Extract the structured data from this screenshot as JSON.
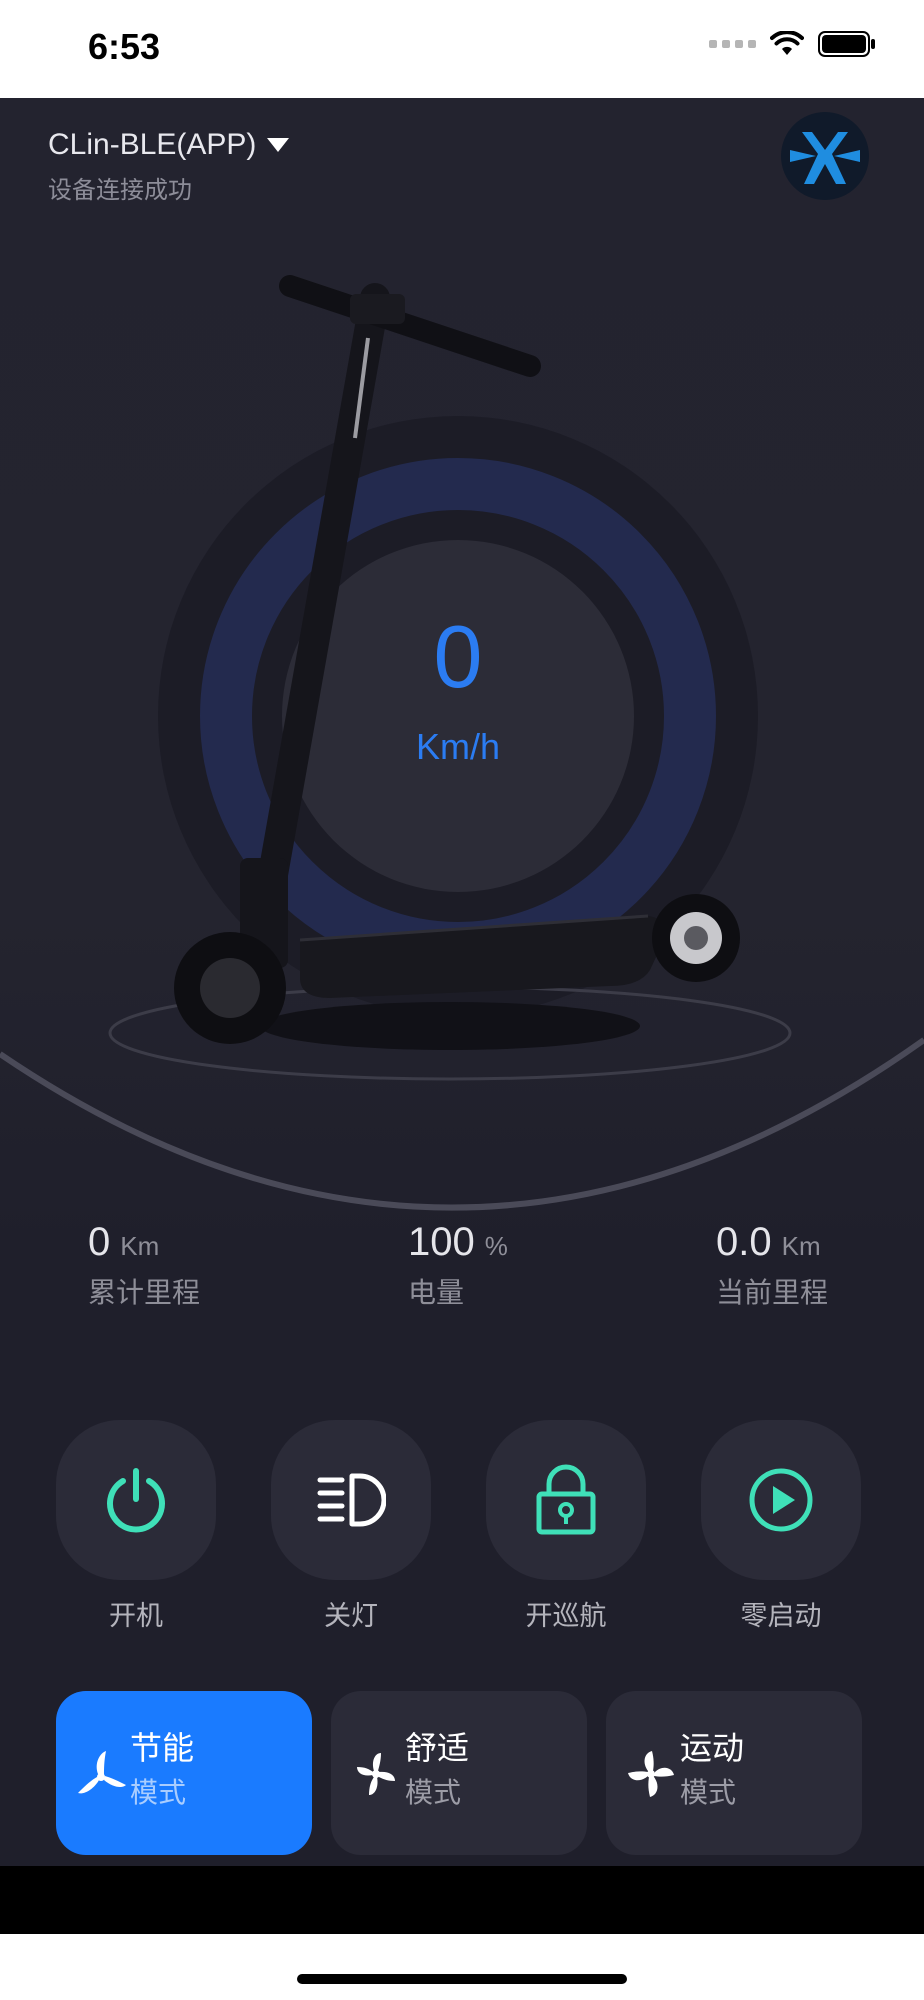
{
  "status_bar": {
    "time": "6:53",
    "icons": [
      "cellular-signal-icon",
      "wifi-icon",
      "battery-icon"
    ]
  },
  "header": {
    "device_name": "CLin-BLE(APP)",
    "connection_status": "设备连接成功",
    "logo_icon": "brand-logo-icon"
  },
  "speed": {
    "value": "0",
    "unit": "Km/h"
  },
  "stats": [
    {
      "value": "0",
      "unit": "Km",
      "label": "累计里程"
    },
    {
      "value": "100",
      "unit": "%",
      "label": "电量"
    },
    {
      "value": "0.0",
      "unit": "Km",
      "label": "当前里程"
    }
  ],
  "controls": [
    {
      "label": "开机",
      "icon": "power-icon"
    },
    {
      "label": "关灯",
      "icon": "headlight-icon"
    },
    {
      "label": "开巡航",
      "icon": "lock-open-icon"
    },
    {
      "label": "零启动",
      "icon": "play-icon"
    }
  ],
  "modes": [
    {
      "name": "节能",
      "sub": "模式",
      "icon": "fan-icon",
      "active": true
    },
    {
      "name": "舒适",
      "sub": "模式",
      "icon": "fan-icon",
      "active": false
    },
    {
      "name": "运动",
      "sub": "模式",
      "icon": "fan-icon",
      "active": false
    }
  ],
  "colors": {
    "background": "#1f1f2b",
    "accent_blue": "#1a7bff",
    "speed_text": "#2b7cf2",
    "icon_teal": "#3fe0b8",
    "gauge_ring": "#232a4e"
  }
}
